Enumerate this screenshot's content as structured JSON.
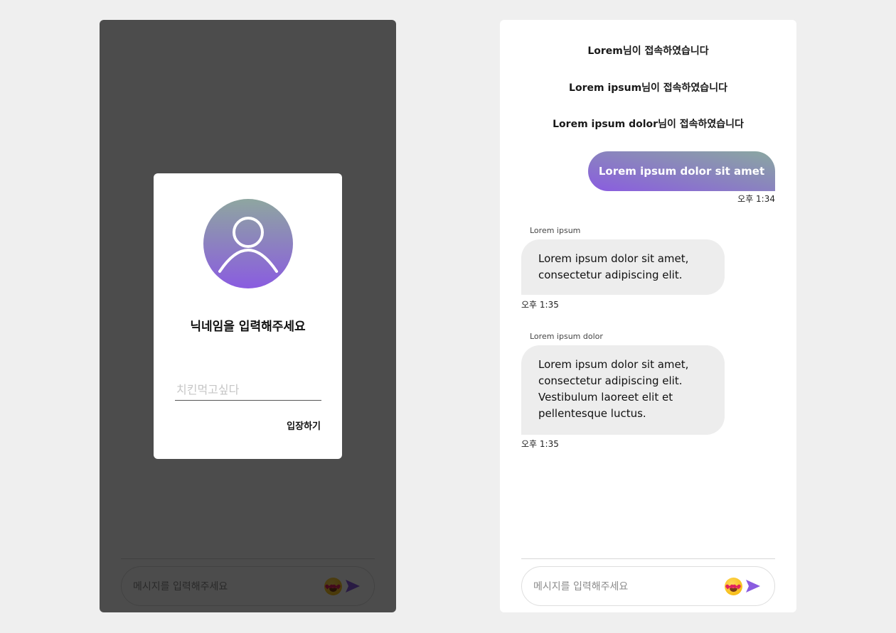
{
  "composer": {
    "placeholder": "메시지를 입력해주세요"
  },
  "login_modal": {
    "title": "닉네임을 입력해주세요",
    "nickname_placeholder": "치킨먹고싶다",
    "enter_label": "입장하기",
    "avatar_icon": "user-icon"
  },
  "chat": {
    "system_messages": [
      "Lorem님이 접속하였습니다",
      "Lorem ipsum님이 접속하였습니다",
      "Lorem ipsum dolor님이 접속하였습니다"
    ],
    "my_message": {
      "text": "Lorem ipsum dolor sit amet",
      "time": "오후 1:34"
    },
    "other_messages": [
      {
        "sender": "Lorem ipsum",
        "text": "Lorem ipsum dolor sit amet, consectetur adipiscing elit.",
        "time": "오후 1:35"
      },
      {
        "sender": "Lorem ipsum dolor",
        "text": "Lorem ipsum dolor sit amet, consectetur adipiscing elit. Vestibulum laoreet elit et pellentesque luctus.",
        "time": "오후 1:35"
      }
    ]
  },
  "icons": {
    "emoji": "heart-eyes-emoji-icon",
    "send": "send-arrow-icon"
  },
  "colors": {
    "accent_purple": "#8a5ce0",
    "accent_teal": "#8aa8a0",
    "bubble_gray": "#ededed",
    "page_background": "#efefef"
  }
}
